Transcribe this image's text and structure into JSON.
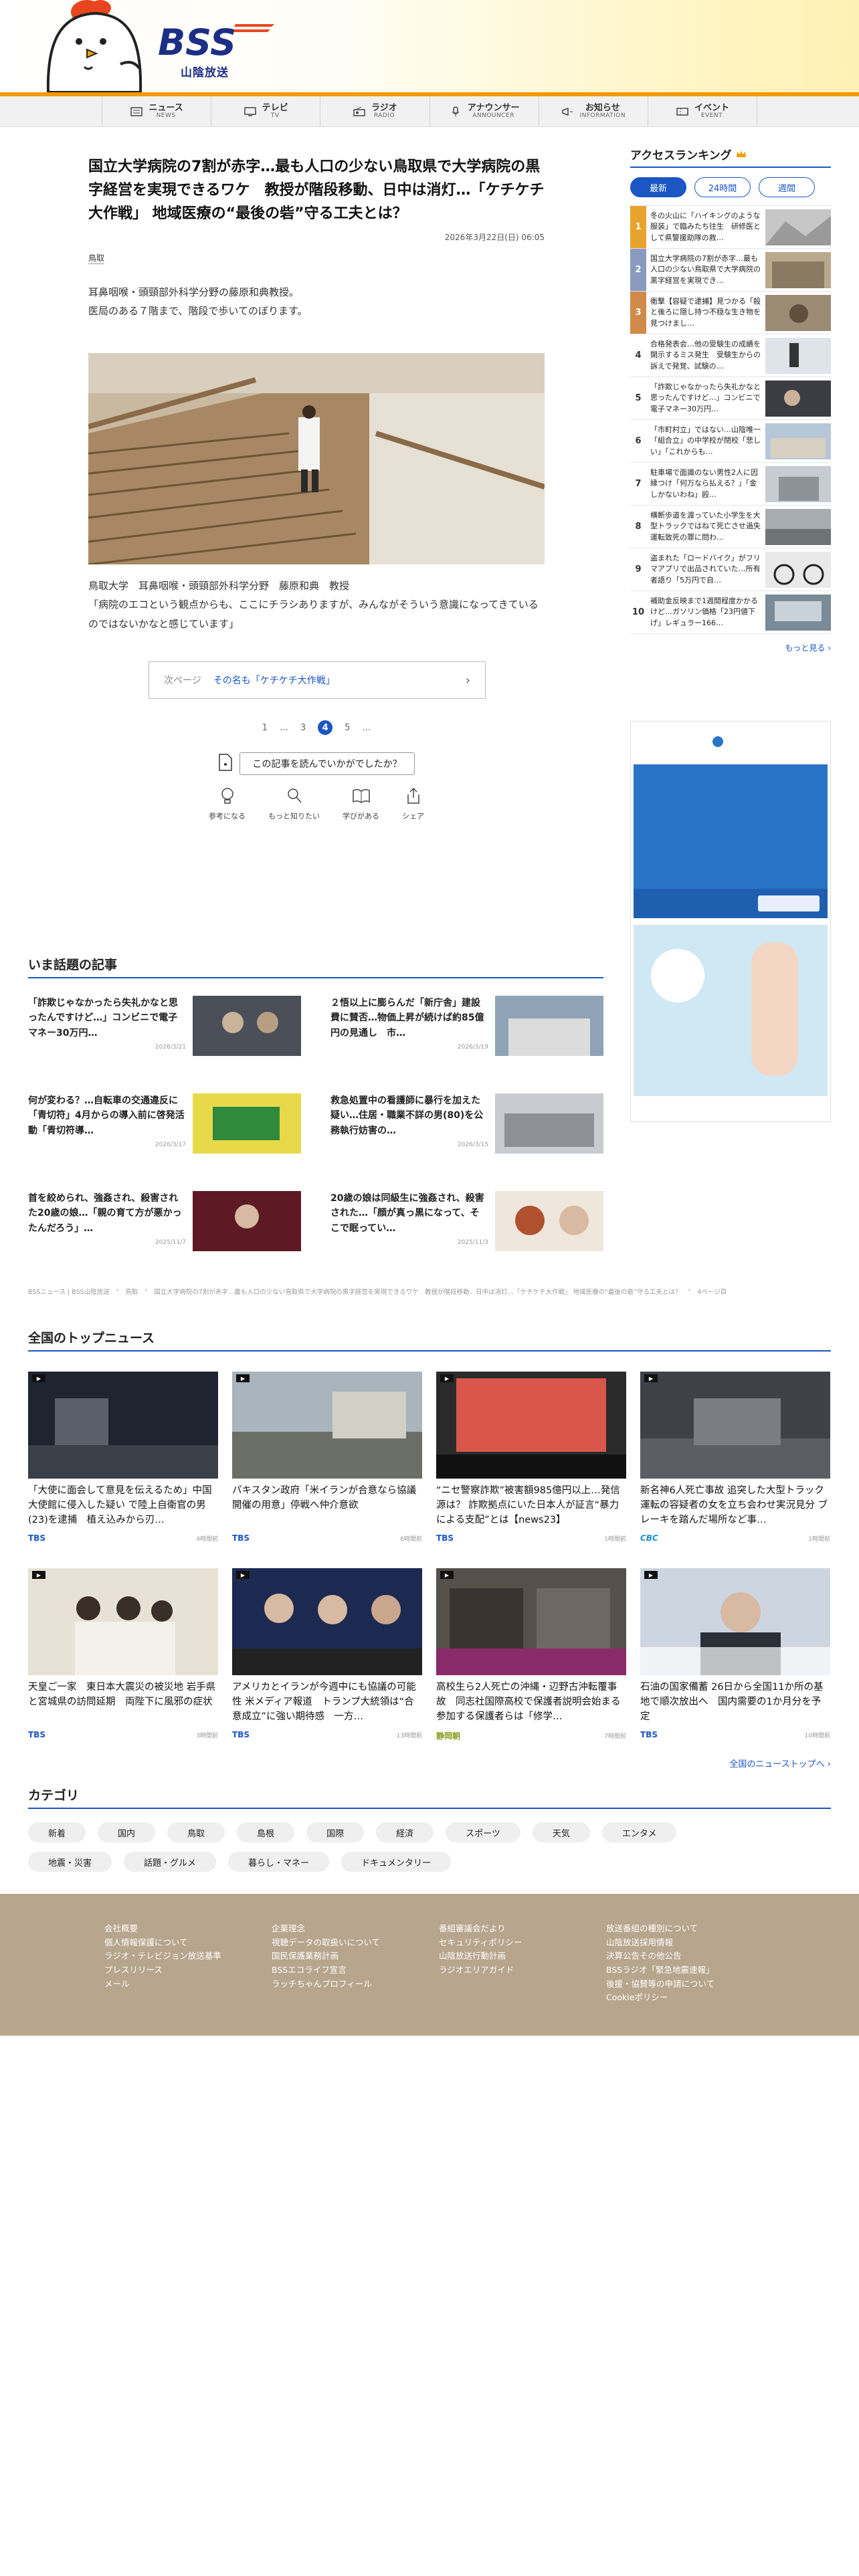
{
  "site": {
    "logo_text": "BSS",
    "logo_sub": "山陰放送"
  },
  "gnav": [
    {
      "jp": "ニュース",
      "en": "NEWS",
      "icon": "newspaper-icon"
    },
    {
      "jp": "テレビ",
      "en": "TV",
      "icon": "tv-icon"
    },
    {
      "jp": "ラジオ",
      "en": "RADIO",
      "icon": "radio-icon"
    },
    {
      "jp": "アナウンサー",
      "en": "ANNOUNCER",
      "icon": "microphone-icon"
    },
    {
      "jp": "お知らせ",
      "en": "INFORMATION",
      "icon": "megaphone-icon"
    },
    {
      "jp": "イベント",
      "en": "EVENT",
      "icon": "ticket-icon"
    }
  ],
  "article": {
    "title": "国立大学病院の7割が赤字…最も人口の少ない鳥取県で大学病院の黒字経営を実現できるワケ　教授が階段移動、日中は消灯…「ケチケチ大作戦」 地域医療の“最後の砦”守る工夫とは？",
    "date": "2026年3月22日(日) 06:05",
    "category": "鳥取",
    "lead1": "耳鼻咽喉・頭頸部外科学分野の藤原和典教授。",
    "lead2": "医局のある７階まで、階段で歩いてのぼります。",
    "caption1": "鳥取大学　耳鼻咽喉・頭頸部外科学分野　藤原和典　教授",
    "caption2": "「病院のエコという観点からも、ここにチラシありますが、みんながそういう意識になってきているのではないかなと感じています」",
    "next_label": "次ページ",
    "next_title": "その名も「ケチケチ大作戦」",
    "pages": [
      "1",
      "…",
      "3",
      "4",
      "5",
      "…"
    ],
    "reaction_q": "この記事を読んでいかがでしたか？",
    "reactions": [
      "参考になる",
      "もっと知りたい",
      "学びがある",
      "シェア"
    ]
  },
  "ranking": {
    "title": "アクセスランキング",
    "tabs": [
      "最新",
      "24時間",
      "週間"
    ],
    "items": [
      {
        "n": "1",
        "t": "冬の火山に「ハイキングのような服装」で臨みたち往生　研修医として県警援助隊の救…"
      },
      {
        "n": "2",
        "t": "国立大学病院の7割が赤字…最も人口の少ない鳥取県で大学病院の黒字経営を実現でき…"
      },
      {
        "n": "3",
        "t": "衝撃【容疑で逮捕】見つかる「殺と後ろに隠し持つ不穏な生き物を見つけまし…"
      },
      {
        "n": "4",
        "t": "合格発表会…他の受験生の成績を開示するミス発生　受験生からの訴えで発覚、試験の…"
      },
      {
        "n": "5",
        "t": "「詐欺じゃなかったら失礼かなと思ったんですけど…」コンビニで電子マネー30万円…"
      },
      {
        "n": "6",
        "t": "「市町村立」ではない…山陰唯一「組合立」の中学校が閉校「悲しい」「これからも…"
      },
      {
        "n": "7",
        "t": "駐車場で面識のない男性2人に因縁つけ「何万なら払える？」「金しかないわね」殴…"
      },
      {
        "n": "8",
        "t": "横断歩道を渡っていた小学生を大型トラックではねて死亡させ過失運転致死の罪に問わ…"
      },
      {
        "n": "9",
        "t": "盗まれた「ロードバイク」がフリマアプリで出品されていた…所有者語り「5万円で自…"
      },
      {
        "n": "10",
        "t": "補助金反映まで1週間程度かかるけど…ガソリン価格「23円値下げ」レギュラー166…"
      }
    ],
    "more": "もっと見る ›"
  },
  "popular": {
    "title": "いま話題の記事",
    "items": [
      {
        "t": "「詐欺じゃなかったら失礼かなと思ったんですけど…」コンビニで電子マネー30万円…",
        "d": "2026/3/21"
      },
      {
        "t": "２悟以上に膨らんだ「新庁舎」建設費に賛否…物価上昇が続けば約85億円の見通し　市…",
        "d": "2026/3/19"
      },
      {
        "t": "何が変わる？…自転車の交通違反に「青切符」4月からの導入前に啓発活動「青切符導…",
        "d": "2026/3/17"
      },
      {
        "t": "救急処置中の看護師に暴行を加えた疑い…住居・職業不詳の男(80)を公務執行妨害の…",
        "d": "2026/3/15"
      },
      {
        "t": "首を絞められ、強姦され、殺害された20歳の娘…「親の育て方が悪かったんだろう」…",
        "d": "2025/11/7"
      },
      {
        "t": "20歳の娘は同級生に強姦され、殺害された…「顔が真っ黒になって、そこで眠ってい…",
        "d": "2025/11/3"
      }
    ]
  },
  "breadcrumb": [
    "BSSニュース | BSS山陰放送",
    "鳥取",
    "国立大学病院の7割が赤字…最も人口の少ない鳥取県で大学病院の黒字経営を実現できるワケ　教授が階段移動、日中は消灯…「ケチケチ大作戦」 地域医療の“最後の砦”守る工夫とは？",
    "4ページ目"
  ],
  "national": {
    "title": "全国のトップニュース",
    "items": [
      {
        "t": "「大使に面会して意見を伝えるため」中国大使館に侵入した疑い で陸上自衛官の男(23)を逮捕　植え込みから刃…",
        "s": "TBS",
        "time": "4時間前"
      },
      {
        "t": "パキスタン政府「米イランが合意なら協議開催の用意」停戦へ仲介意欲",
        "s": "TBS",
        "time": "6時間前"
      },
      {
        "t": "“ニセ警察詐欺”被害額985億円以上…発信源は？ 詐欺拠点にいた日本人が証言“暴力による支配”とは【news23】",
        "s": "TBS",
        "time": "1時間前"
      },
      {
        "t": "新名神6人死亡事故 追突した大型トラック運転の容疑者の女を立ち会わせ実況見分 ブレーキを踏んだ場所など事…",
        "s": "CBC",
        "time": "1時間前"
      },
      {
        "t": "天皇ご一家　東日本大震災の被災地 岩手県と宮城県の訪問延期　両陛下に風邪の症状",
        "s": "TBS",
        "time": "3時間前"
      },
      {
        "t": "アメリカとイランが今週中にも協議の可能性 米メディア報道　トランプ大統領は“合意成立”に強い期待感　一方…",
        "s": "TBS",
        "time": "13時間前"
      },
      {
        "t": "高校生ら2人死亡の沖縄・辺野古沖転覆事故　同志社国際高校で保護者説明会始まる　参加する保護者らは「修学…",
        "s": "静岡朝",
        "time": "7時間前"
      },
      {
        "t": "石油の国家備蓄 26日から全国11か所の基地で順次放出へ　国内需要の1か月分を予定",
        "s": "TBS",
        "time": "10時間前"
      }
    ],
    "more": "全国のニューストップへ ›"
  },
  "categories": {
    "title": "カテゴリ",
    "items": [
      "新着",
      "国内",
      "鳥取",
      "島根",
      "国際",
      "経済",
      "スポーツ",
      "天気",
      "エンタメ",
      "地震・災害",
      "話題・グルメ",
      "暮らし・マネー",
      "ドキュメンタリー"
    ]
  },
  "footer": {
    "cols": [
      [
        "会社概要",
        "個人情報保護について",
        "ラジオ・テレビジョン放送基準",
        "プレスリリース",
        "メール"
      ],
      [
        "企業理念",
        "視聴データの取扱いについて",
        "国民保護業務計画",
        "BSSエコライフ宣言",
        "ラッチちゃんプロフィール"
      ],
      [
        "番組審議会だより",
        "セキュリティポリシー",
        "山陰放送行動計画",
        "ラジオエリアガイド"
      ],
      [
        "放送番組の種別について",
        "山陰放送採用情報",
        "決算公告その他公告",
        "BSSラジオ「緊急地震速報」",
        "後援・協賛等の申請について",
        "Cookieポリシー"
      ]
    ]
  },
  "colors": {
    "accent": "#1a56c4",
    "header_orange": "#f39800",
    "footer_bg": "#b7a58d"
  }
}
